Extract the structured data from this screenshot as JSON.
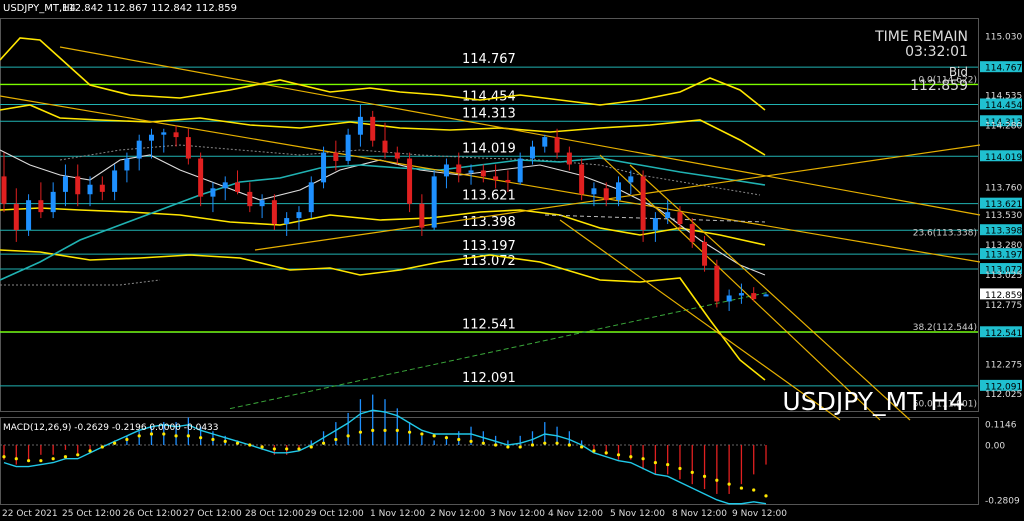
{
  "header": {
    "symbol_info": "USDJPY_MT,H4",
    "ohlc": "112.842 112.867 112.842 112.859"
  },
  "overlay": {
    "time_remain_label": "TIME REMAIN",
    "time_remain_value": "03:32:01",
    "bid_label": "Bid",
    "bid_value": "112.859",
    "watermark": "USDJPY_MT H4"
  },
  "macd": {
    "label": "MACD(12,26,9) -0.2629 -0.2196 0.0000 -0.0433",
    "axis_ticks": [
      "0.1146",
      "0.00",
      "-0.2809"
    ]
  },
  "colors": {
    "background": "#000000",
    "bull": "#1e90ff",
    "bear": "#e02020",
    "level_line": "#20b2b2",
    "price_tag_bg": "#20c0d0",
    "bands": "#ffe600",
    "trendlines": "#e6b000",
    "fib": "#7cfc00",
    "macd_signal": "#ffe600",
    "macd_line": "#20c8e8",
    "ema": "#20b2b2"
  },
  "chart_data": {
    "type": "candlestick",
    "symbol": "USDJPY_MT",
    "timeframe": "H4",
    "y_axis_ticks": [
      "115.030",
      "114.767",
      "114.535",
      "114.454",
      "114.313",
      "114.280",
      "114.019",
      "113.760",
      "113.621",
      "113.530",
      "113.398",
      "113.280",
      "113.197",
      "113.072",
      "113.025",
      "112.859",
      "112.775",
      "112.541",
      "112.275",
      "112.091",
      "112.025"
    ],
    "x_axis_ticks": [
      "22 Oct 2021",
      "25 Oct 12:00",
      "26 Oct 12:00",
      "27 Oct 12:00",
      "28 Oct 12:00",
      "29 Oct 12:00",
      "1 Nov 12:00",
      "2 Nov 12:00",
      "3 Nov 12:00",
      "4 Nov 12:00",
      "5 Nov 12:00",
      "8 Nov 12:00",
      "9 Nov 12:00"
    ],
    "level_labels": [
      "114.767",
      "114.454",
      "114.313",
      "114.019",
      "113.621",
      "113.398",
      "113.197",
      "113.072",
      "112.541",
      "112.091"
    ],
    "highlight_tags": [
      "114.767",
      "114.454",
      "114.313",
      "114.019",
      "113.621",
      "113.398",
      "113.197",
      "113.072",
      "112.859",
      "112.541",
      "112.091"
    ],
    "fib_labels": [
      "0.0(114.622)",
      "23.6(113.338)",
      "38.2(112.544)",
      "50.0(111.901)"
    ],
    "candles": [
      {
        "o": 113.85,
        "h": 114.05,
        "l": 113.55,
        "c": 113.62
      },
      {
        "o": 113.62,
        "h": 113.75,
        "l": 113.3,
        "c": 113.4
      },
      {
        "o": 113.4,
        "h": 113.7,
        "l": 113.35,
        "c": 113.65
      },
      {
        "o": 113.65,
        "h": 113.8,
        "l": 113.5,
        "c": 113.55
      },
      {
        "o": 113.55,
        "h": 113.8,
        "l": 113.5,
        "c": 113.72
      },
      {
        "o": 113.72,
        "h": 113.95,
        "l": 113.6,
        "c": 113.85
      },
      {
        "o": 113.85,
        "h": 113.95,
        "l": 113.6,
        "c": 113.7
      },
      {
        "o": 113.7,
        "h": 113.85,
        "l": 113.6,
        "c": 113.78
      },
      {
        "o": 113.78,
        "h": 113.85,
        "l": 113.65,
        "c": 113.72
      },
      {
        "o": 113.72,
        "h": 113.95,
        "l": 113.65,
        "c": 113.9
      },
      {
        "o": 113.9,
        "h": 114.05,
        "l": 113.8,
        "c": 114.0
      },
      {
        "o": 114.0,
        "h": 114.2,
        "l": 113.9,
        "c": 114.15
      },
      {
        "o": 114.15,
        "h": 114.25,
        "l": 114.0,
        "c": 114.2
      },
      {
        "o": 114.2,
        "h": 114.25,
        "l": 114.05,
        "c": 114.22
      },
      {
        "o": 114.22,
        "h": 114.28,
        "l": 114.1,
        "c": 114.18
      },
      {
        "o": 114.18,
        "h": 114.25,
        "l": 113.95,
        "c": 114.0
      },
      {
        "o": 114.0,
        "h": 114.05,
        "l": 113.6,
        "c": 113.68
      },
      {
        "o": 113.68,
        "h": 113.8,
        "l": 113.55,
        "c": 113.75
      },
      {
        "o": 113.75,
        "h": 113.85,
        "l": 113.65,
        "c": 113.8
      },
      {
        "o": 113.8,
        "h": 113.9,
        "l": 113.7,
        "c": 113.72
      },
      {
        "o": 113.72,
        "h": 113.8,
        "l": 113.55,
        "c": 113.6
      },
      {
        "o": 113.6,
        "h": 113.7,
        "l": 113.5,
        "c": 113.65
      },
      {
        "o": 113.65,
        "h": 113.7,
        "l": 113.4,
        "c": 113.45
      },
      {
        "o": 113.45,
        "h": 113.55,
        "l": 113.35,
        "c": 113.5
      },
      {
        "o": 113.5,
        "h": 113.6,
        "l": 113.4,
        "c": 113.55
      },
      {
        "o": 113.55,
        "h": 113.85,
        "l": 113.5,
        "c": 113.8
      },
      {
        "o": 113.8,
        "h": 114.1,
        "l": 113.75,
        "c": 114.05
      },
      {
        "o": 114.05,
        "h": 114.15,
        "l": 113.9,
        "c": 113.98
      },
      {
        "o": 113.98,
        "h": 114.25,
        "l": 113.95,
        "c": 114.2
      },
      {
        "o": 114.2,
        "h": 114.45,
        "l": 114.1,
        "c": 114.35
      },
      {
        "o": 114.35,
        "h": 114.4,
        "l": 114.1,
        "c": 114.15
      },
      {
        "o": 114.15,
        "h": 114.3,
        "l": 114.0,
        "c": 114.05
      },
      {
        "o": 114.05,
        "h": 114.1,
        "l": 113.95,
        "c": 114.0
      },
      {
        "o": 114.0,
        "h": 114.05,
        "l": 113.55,
        "c": 113.62
      },
      {
        "o": 113.62,
        "h": 113.7,
        "l": 113.35,
        "c": 113.42
      },
      {
        "o": 113.42,
        "h": 113.9,
        "l": 113.4,
        "c": 113.85
      },
      {
        "o": 113.85,
        "h": 114.0,
        "l": 113.75,
        "c": 113.95
      },
      {
        "o": 113.95,
        "h": 114.05,
        "l": 113.8,
        "c": 113.88
      },
      {
        "o": 113.88,
        "h": 113.95,
        "l": 113.78,
        "c": 113.9
      },
      {
        "o": 113.9,
        "h": 113.95,
        "l": 113.8,
        "c": 113.85
      },
      {
        "o": 113.85,
        "h": 113.95,
        "l": 113.75,
        "c": 113.82
      },
      {
        "o": 113.82,
        "h": 113.9,
        "l": 113.72,
        "c": 113.8
      },
      {
        "o": 113.8,
        "h": 114.05,
        "l": 113.78,
        "c": 114.0
      },
      {
        "o": 114.0,
        "h": 114.15,
        "l": 113.95,
        "c": 114.1
      },
      {
        "o": 114.1,
        "h": 114.2,
        "l": 114.05,
        "c": 114.18
      },
      {
        "o": 114.18,
        "h": 114.25,
        "l": 114.0,
        "c": 114.05
      },
      {
        "o": 114.05,
        "h": 114.1,
        "l": 113.9,
        "c": 113.95
      },
      {
        "o": 113.95,
        "h": 114.0,
        "l": 113.65,
        "c": 113.7
      },
      {
        "o": 113.7,
        "h": 113.8,
        "l": 113.6,
        "c": 113.75
      },
      {
        "o": 113.75,
        "h": 113.8,
        "l": 113.6,
        "c": 113.65
      },
      {
        "o": 113.65,
        "h": 113.85,
        "l": 113.6,
        "c": 113.8
      },
      {
        "o": 113.8,
        "h": 113.9,
        "l": 113.7,
        "c": 113.85
      },
      {
        "o": 113.85,
        "h": 113.9,
        "l": 113.3,
        "c": 113.4
      },
      {
        "o": 113.4,
        "h": 113.55,
        "l": 113.3,
        "c": 113.5
      },
      {
        "o": 113.5,
        "h": 113.65,
        "l": 113.45,
        "c": 113.55
      },
      {
        "o": 113.55,
        "h": 113.6,
        "l": 113.4,
        "c": 113.45
      },
      {
        "o": 113.45,
        "h": 113.5,
        "l": 113.25,
        "c": 113.3
      },
      {
        "o": 113.3,
        "h": 113.35,
        "l": 113.05,
        "c": 113.1
      },
      {
        "o": 113.1,
        "h": 113.15,
        "l": 112.75,
        "c": 112.8
      },
      {
        "o": 112.8,
        "h": 112.9,
        "l": 112.72,
        "c": 112.85
      },
      {
        "o": 112.85,
        "h": 112.95,
        "l": 112.78,
        "c": 112.87
      },
      {
        "o": 112.87,
        "h": 112.92,
        "l": 112.8,
        "c": 112.82
      },
      {
        "o": 112.842,
        "h": 112.867,
        "l": 112.842,
        "c": 112.859
      }
    ],
    "macd_hist": [
      -0.03,
      -0.04,
      -0.03,
      -0.02,
      -0.02,
      -0.01,
      -0.02,
      -0.01,
      0.0,
      0.01,
      0.02,
      0.03,
      0.04,
      0.05,
      0.05,
      0.06,
      0.04,
      0.03,
      0.02,
      0.01,
      0.0,
      -0.01,
      -0.02,
      -0.02,
      -0.01,
      0.01,
      0.03,
      0.05,
      0.07,
      0.1,
      0.11,
      0.1,
      0.08,
      0.05,
      0.02,
      0.01,
      0.02,
      0.03,
      0.04,
      0.03,
      0.02,
      0.01,
      0.02,
      0.03,
      0.05,
      0.04,
      0.03,
      0.01,
      -0.01,
      -0.02,
      -0.03,
      -0.03,
      -0.05,
      -0.06,
      -0.06,
      -0.07,
      -0.08,
      -0.09,
      -0.1,
      -0.1,
      -0.08,
      -0.06,
      -0.04
    ],
    "macd_signal": [
      -0.06,
      -0.07,
      -0.08,
      -0.08,
      -0.07,
      -0.06,
      -0.05,
      -0.03,
      -0.01,
      0.01,
      0.03,
      0.05,
      0.06,
      0.06,
      0.05,
      0.05,
      0.04,
      0.03,
      0.02,
      0.01,
      0.0,
      -0.01,
      -0.02,
      -0.02,
      -0.02,
      -0.01,
      0.01,
      0.03,
      0.05,
      0.07,
      0.08,
      0.08,
      0.08,
      0.07,
      0.06,
      0.05,
      0.04,
      0.03,
      0.02,
      0.01,
      0.0,
      -0.01,
      -0.01,
      0.0,
      0.01,
      0.01,
      0.0,
      -0.01,
      -0.03,
      -0.04,
      -0.05,
      -0.06,
      -0.07,
      -0.09,
      -0.1,
      -0.12,
      -0.14,
      -0.16,
      -0.18,
      -0.2,
      -0.22,
      -0.23,
      -0.26
    ],
    "macd_line": [
      -0.09,
      -0.11,
      -0.11,
      -0.1,
      -0.09,
      -0.07,
      -0.07,
      -0.04,
      -0.01,
      0.02,
      0.05,
      0.08,
      0.1,
      0.11,
      0.1,
      0.11,
      0.08,
      0.06,
      0.04,
      0.02,
      0.0,
      -0.02,
      -0.04,
      -0.04,
      -0.03,
      0.0,
      0.04,
      0.08,
      0.12,
      0.17,
      0.19,
      0.18,
      0.16,
      0.12,
      0.08,
      0.06,
      0.06,
      0.06,
      0.06,
      0.04,
      0.02,
      0.0,
      0.01,
      0.03,
      0.06,
      0.05,
      0.03,
      0.0,
      -0.04,
      -0.06,
      -0.08,
      -0.09,
      -0.12,
      -0.15,
      -0.16,
      -0.19,
      -0.22,
      -0.25,
      -0.28,
      -0.3,
      -0.3,
      -0.29,
      -0.3
    ]
  }
}
